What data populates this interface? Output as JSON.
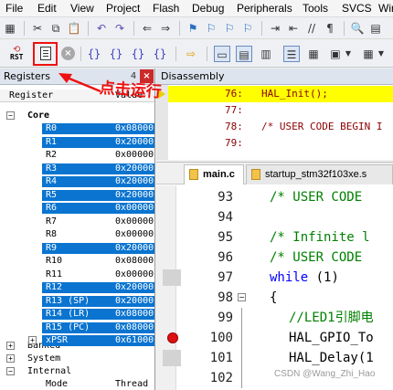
{
  "menubar": {
    "items": [
      "File",
      "Edit",
      "View",
      "Project",
      "Flash",
      "Debug",
      "Peripherals",
      "Tools",
      "SVCS",
      "Win"
    ]
  },
  "toolbar2": {
    "reset_label": "RST",
    "brace_icons": [
      "{}",
      "{}",
      "{}",
      "{}"
    ]
  },
  "registers": {
    "title": "Registers",
    "pin_glyph": "4",
    "close_glyph": "×",
    "col_register": "Register",
    "col_value": "Value",
    "groups": {
      "core": "Core",
      "banked": "Banked",
      "system": "System",
      "internal": "Internal"
    },
    "rows": [
      {
        "name": "R0",
        "value": "0x08000",
        "selected": true
      },
      {
        "name": "R1",
        "value": "0x20000",
        "selected": true
      },
      {
        "name": "R2",
        "value": "0x00000",
        "selected": false
      },
      {
        "name": "R3",
        "value": "0x20000",
        "selected": true
      },
      {
        "name": "R4",
        "value": "0x20000",
        "selected": true
      },
      {
        "name": "R5",
        "value": "0x20000",
        "selected": true
      },
      {
        "name": "R6",
        "value": "0x00000",
        "selected": true
      },
      {
        "name": "R7",
        "value": "0x00000",
        "selected": false
      },
      {
        "name": "R8",
        "value": "0x00000",
        "selected": false
      },
      {
        "name": "R9",
        "value": "0x20000",
        "selected": true
      },
      {
        "name": "R10",
        "value": "0x08000",
        "selected": false
      },
      {
        "name": "R11",
        "value": "0x00000",
        "selected": false
      },
      {
        "name": "R12",
        "value": "0x20000",
        "selected": true
      },
      {
        "name": "R13 (SP)",
        "value": "0x20000",
        "selected": true
      },
      {
        "name": "R14 (LR)",
        "value": "0x08000",
        "selected": true
      },
      {
        "name": "R15 (PC)",
        "value": "0x08000",
        "selected": true
      },
      {
        "name": "xPSR",
        "value": "0x61000",
        "selected": true
      }
    ],
    "mode_label": "Mode",
    "mode_value": "Thread"
  },
  "disassembly": {
    "title": "Disassembly",
    "lines": [
      {
        "num": "76:",
        "code": "HAL_Init();",
        "current": true
      },
      {
        "num": "77:",
        "code": "",
        "current": false
      },
      {
        "num": "78:",
        "code": "/* USER CODE BEGIN I",
        "current": false
      },
      {
        "num": "79:",
        "code": "",
        "current": false
      }
    ]
  },
  "editor": {
    "tabs": [
      {
        "label": "main.c",
        "active": true
      },
      {
        "label": "startup_stm32f103xe.s",
        "active": false
      }
    ],
    "lines": [
      {
        "num": "93",
        "code": "/* USER CODE",
        "indent": 0,
        "style": "comment",
        "mark": "",
        "fold": ""
      },
      {
        "num": "94",
        "code": "",
        "indent": 0,
        "style": "plain",
        "mark": "",
        "fold": ""
      },
      {
        "num": "95",
        "code": "/* Infinite l",
        "indent": 0,
        "style": "comment",
        "mark": "",
        "fold": ""
      },
      {
        "num": "96",
        "code": "/* USER CODE",
        "indent": 0,
        "style": "comment",
        "mark": "",
        "fold": ""
      },
      {
        "num": "97",
        "code": "while (1)",
        "indent": 0,
        "style": "while",
        "mark": "gray",
        "fold": ""
      },
      {
        "num": "98",
        "code": "{",
        "indent": 0,
        "style": "plain",
        "mark": "",
        "fold": "open"
      },
      {
        "num": "99",
        "code": "//LED1引脚电",
        "indent": 1,
        "style": "comment",
        "mark": "",
        "fold": "line"
      },
      {
        "num": "100",
        "code": "HAL_GPIO_To",
        "indent": 1,
        "style": "plain",
        "mark": "breakpoint",
        "fold": "line"
      },
      {
        "num": "101",
        "code": "HAL_Delay(1",
        "indent": 1,
        "style": "plain",
        "mark": "gray",
        "fold": "line"
      },
      {
        "num": "102",
        "code": "",
        "indent": 0,
        "style": "plain",
        "mark": "",
        "fold": "line"
      }
    ]
  },
  "annotation": "点击运行",
  "watermark": "CSDN @Wang_Zhi_Hao",
  "colors": {
    "selection": "#0a74d0",
    "comment": "#008000",
    "keyword": "#0000ff",
    "current_line": "#ffff00",
    "disasm_code": "#8b0000",
    "annotation": "#ee1111",
    "close_button": "#cc2a2a"
  }
}
